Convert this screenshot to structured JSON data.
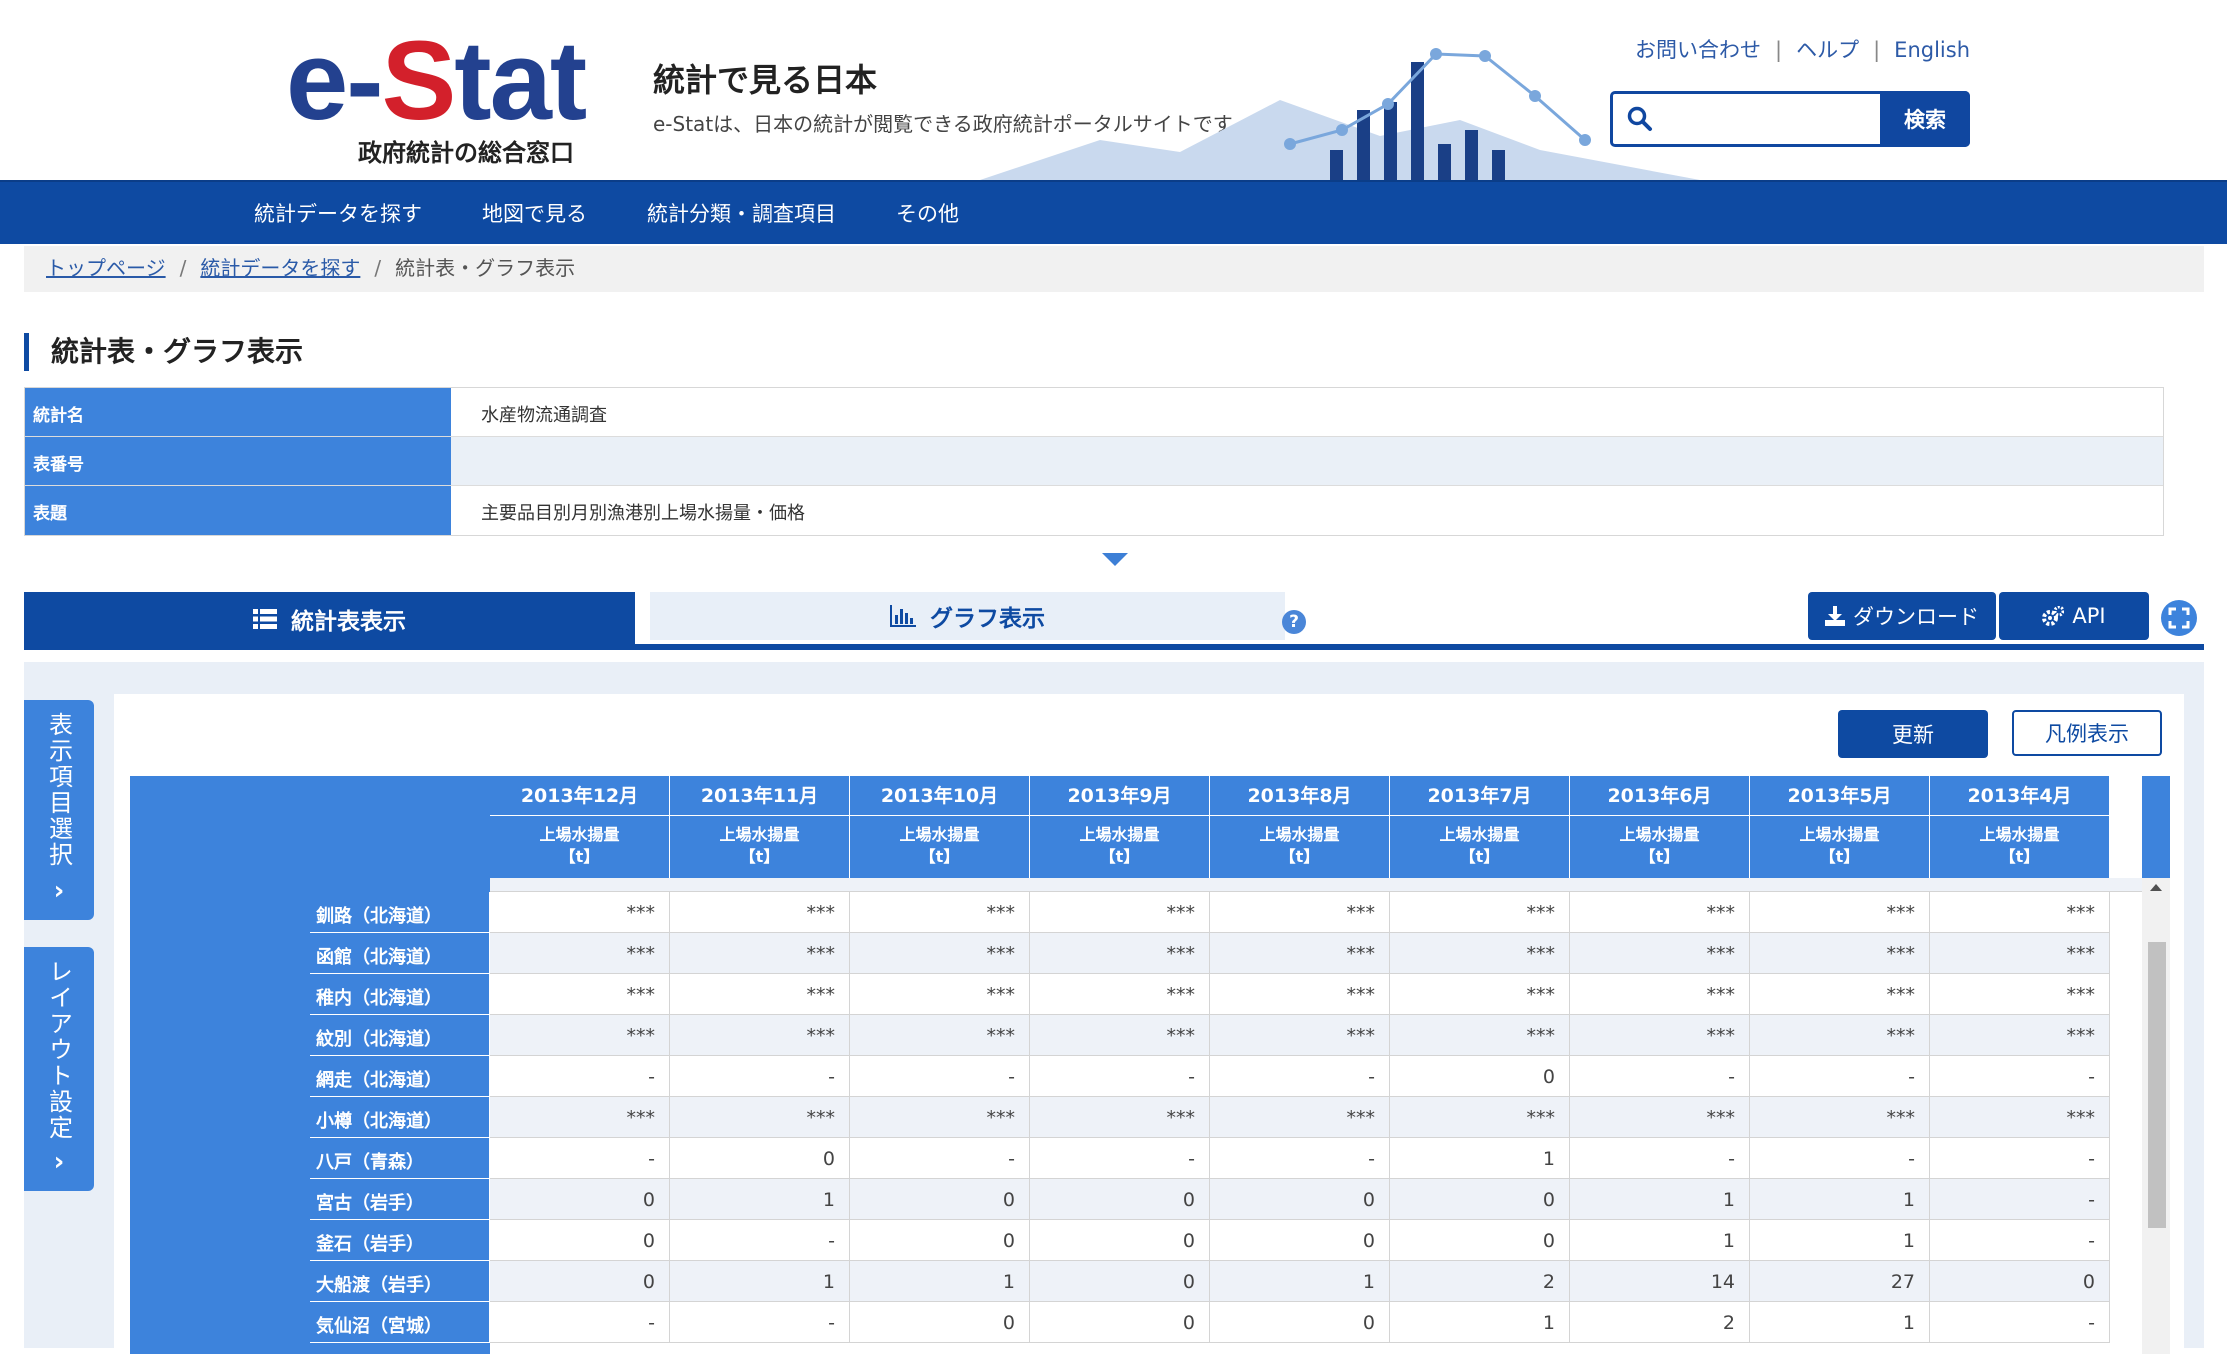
{
  "brand": {
    "logo_e": "e-",
    "logo_s": "S",
    "logo_tat": "tat",
    "logo_sub": "政府統計の総合窓口",
    "tagline_title": "統計で見る日本",
    "tagline_sub": "e-Statは、日本の統計が閲覧できる政府統計ポータルサイトです"
  },
  "util_links": [
    "お問い合わせ",
    "ヘルプ",
    "English"
  ],
  "search": {
    "placeholder": "",
    "button": "検索"
  },
  "nav": [
    "統計データを探す",
    "地図で見る",
    "統計分類・調査項目",
    "その他"
  ],
  "breadcrumb": {
    "items": [
      "トップページ",
      "統計データを探す"
    ],
    "current": "統計表・グラフ表示"
  },
  "page_title": "統計表・グラフ表示",
  "meta": [
    {
      "key": "統計名",
      "value": "水産物流通調査"
    },
    {
      "key": "表番号",
      "value": ""
    },
    {
      "key": "表題",
      "value": "主要品目別月別漁港別上場水揚量・価格"
    }
  ],
  "tabs": {
    "table": "統計表表示",
    "graph": "グラフ表示"
  },
  "buttons": {
    "download": "ダウンロード",
    "api": "API",
    "update": "更新",
    "legend": "凡例表示"
  },
  "side": {
    "items": "表示項目選択",
    "layout": "レイアウト設定"
  },
  "table": {
    "columns": [
      {
        "date": "2013年12月",
        "measure": "上場水揚量",
        "unit": "【t】"
      },
      {
        "date": "2013年11月",
        "measure": "上場水揚量",
        "unit": "【t】"
      },
      {
        "date": "2013年10月",
        "measure": "上場水揚量",
        "unit": "【t】"
      },
      {
        "date": "2013年9月",
        "measure": "上場水揚量",
        "unit": "【t】"
      },
      {
        "date": "2013年8月",
        "measure": "上場水揚量",
        "unit": "【t】"
      },
      {
        "date": "2013年7月",
        "measure": "上場水揚量",
        "unit": "【t】"
      },
      {
        "date": "2013年6月",
        "measure": "上場水揚量",
        "unit": "【t】"
      },
      {
        "date": "2013年5月",
        "measure": "上場水揚量",
        "unit": "【t】"
      },
      {
        "date": "2013年4月",
        "measure": "上場水揚量",
        "unit": "【t】"
      }
    ],
    "rows": [
      {
        "label": "釧路（北海道）",
        "values": [
          "***",
          "***",
          "***",
          "***",
          "***",
          "***",
          "***",
          "***",
          "***"
        ]
      },
      {
        "label": "函館（北海道）",
        "values": [
          "***",
          "***",
          "***",
          "***",
          "***",
          "***",
          "***",
          "***",
          "***"
        ]
      },
      {
        "label": "稚内（北海道）",
        "values": [
          "***",
          "***",
          "***",
          "***",
          "***",
          "***",
          "***",
          "***",
          "***"
        ]
      },
      {
        "label": "紋別（北海道）",
        "values": [
          "***",
          "***",
          "***",
          "***",
          "***",
          "***",
          "***",
          "***",
          "***"
        ]
      },
      {
        "label": "網走（北海道）",
        "values": [
          "-",
          "-",
          "-",
          "-",
          "-",
          "0",
          "-",
          "-",
          "-"
        ]
      },
      {
        "label": "小樽（北海道）",
        "values": [
          "***",
          "***",
          "***",
          "***",
          "***",
          "***",
          "***",
          "***",
          "***"
        ]
      },
      {
        "label": "八戸（青森）",
        "values": [
          "-",
          "0",
          "-",
          "-",
          "-",
          "1",
          "-",
          "-",
          "-"
        ]
      },
      {
        "label": "宮古（岩手）",
        "values": [
          "0",
          "1",
          "0",
          "0",
          "0",
          "0",
          "1",
          "1",
          "-"
        ]
      },
      {
        "label": "釜石（岩手）",
        "values": [
          "0",
          "-",
          "0",
          "0",
          "0",
          "0",
          "1",
          "1",
          "-"
        ]
      },
      {
        "label": "大船渡（岩手）",
        "values": [
          "0",
          "1",
          "1",
          "0",
          "1",
          "2",
          "14",
          "27",
          "0"
        ]
      },
      {
        "label": "気仙沼（宮城）",
        "values": [
          "-",
          "-",
          "0",
          "0",
          "0",
          "1",
          "2",
          "1",
          "-"
        ]
      }
    ]
  }
}
